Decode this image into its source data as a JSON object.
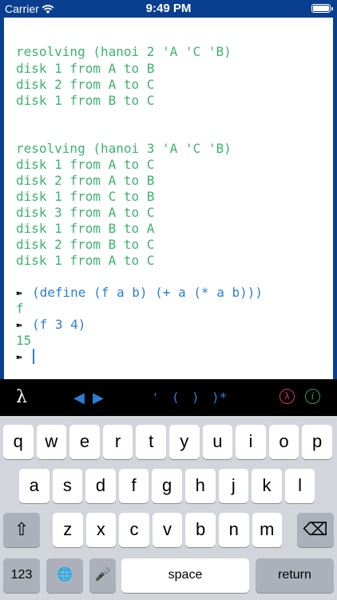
{
  "status_bar": {
    "carrier": "Carrier",
    "time": "9:49 PM"
  },
  "console": {
    "lines": [
      {
        "text": "resolving (hanoi 2 'A 'C 'B)",
        "kind": "output"
      },
      {
        "text": "disk 1 from A to B",
        "kind": "output"
      },
      {
        "text": "disk 2 from A to C",
        "kind": "output"
      },
      {
        "text": "disk 1 from B to C",
        "kind": "output"
      },
      {
        "text": "resolving (hanoi 3 'A 'C 'B)",
        "kind": "output"
      },
      {
        "text": "disk 1 from A to C",
        "kind": "output"
      },
      {
        "text": "disk 2 from A to B",
        "kind": "output"
      },
      {
        "text": "disk 1 from C to B",
        "kind": "output"
      },
      {
        "text": "disk 3 from A to C",
        "kind": "output"
      },
      {
        "text": "disk 1 from B to A",
        "kind": "output"
      },
      {
        "text": "disk 2 from B to C",
        "kind": "output"
      },
      {
        "text": "disk 1 from A to C",
        "kind": "output"
      },
      {
        "text": "(define (f a b) (+ a (* a b)))",
        "kind": "input"
      },
      {
        "text": "f",
        "kind": "output"
      },
      {
        "text": "(f 3 4)",
        "kind": "input"
      },
      {
        "text": "15",
        "kind": "output"
      },
      {
        "text": "",
        "kind": "prompt"
      }
    ],
    "prompt_glyph": "➽"
  },
  "toolbar": {
    "lambda": "λ",
    "arrow_left": "◀",
    "arrow_right": "▶",
    "quote": "'",
    "open_paren": "(",
    "close_paren": ")",
    "close_all": ")*",
    "lambda_circle": "λ",
    "info_circle": "i"
  },
  "keyboard": {
    "row1": [
      "q",
      "w",
      "e",
      "r",
      "t",
      "y",
      "u",
      "i",
      "o",
      "p"
    ],
    "row2": [
      "a",
      "s",
      "d",
      "f",
      "g",
      "h",
      "j",
      "k",
      "l"
    ],
    "row3": [
      "z",
      "x",
      "c",
      "v",
      "b",
      "n",
      "m"
    ],
    "shift": "⇧",
    "backspace": "⌫",
    "numbers": "123",
    "globe": "🌐",
    "mic": "🎤",
    "space": "space",
    "return": "return"
  },
  "colors": {
    "output": "#3cb371",
    "input": "#2a7fd4",
    "frame": "#0a3e8e"
  }
}
